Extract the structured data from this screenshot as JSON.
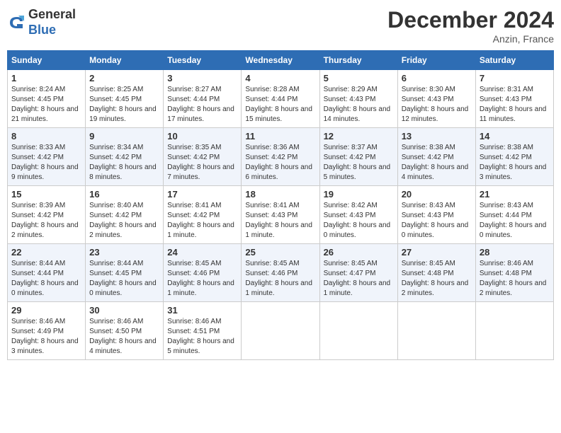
{
  "header": {
    "logo_line1": "General",
    "logo_line2": "Blue",
    "month_title": "December 2024",
    "location": "Anzin, France"
  },
  "weekdays": [
    "Sunday",
    "Monday",
    "Tuesday",
    "Wednesday",
    "Thursday",
    "Friday",
    "Saturday"
  ],
  "weeks": [
    [
      {
        "day": "1",
        "sunrise": "Sunrise: 8:24 AM",
        "sunset": "Sunset: 4:45 PM",
        "daylight": "Daylight: 8 hours and 21 minutes."
      },
      {
        "day": "2",
        "sunrise": "Sunrise: 8:25 AM",
        "sunset": "Sunset: 4:45 PM",
        "daylight": "Daylight: 8 hours and 19 minutes."
      },
      {
        "day": "3",
        "sunrise": "Sunrise: 8:27 AM",
        "sunset": "Sunset: 4:44 PM",
        "daylight": "Daylight: 8 hours and 17 minutes."
      },
      {
        "day": "4",
        "sunrise": "Sunrise: 8:28 AM",
        "sunset": "Sunset: 4:44 PM",
        "daylight": "Daylight: 8 hours and 15 minutes."
      },
      {
        "day": "5",
        "sunrise": "Sunrise: 8:29 AM",
        "sunset": "Sunset: 4:43 PM",
        "daylight": "Daylight: 8 hours and 14 minutes."
      },
      {
        "day": "6",
        "sunrise": "Sunrise: 8:30 AM",
        "sunset": "Sunset: 4:43 PM",
        "daylight": "Daylight: 8 hours and 12 minutes."
      },
      {
        "day": "7",
        "sunrise": "Sunrise: 8:31 AM",
        "sunset": "Sunset: 4:43 PM",
        "daylight": "Daylight: 8 hours and 11 minutes."
      }
    ],
    [
      {
        "day": "8",
        "sunrise": "Sunrise: 8:33 AM",
        "sunset": "Sunset: 4:42 PM",
        "daylight": "Daylight: 8 hours and 9 minutes."
      },
      {
        "day": "9",
        "sunrise": "Sunrise: 8:34 AM",
        "sunset": "Sunset: 4:42 PM",
        "daylight": "Daylight: 8 hours and 8 minutes."
      },
      {
        "day": "10",
        "sunrise": "Sunrise: 8:35 AM",
        "sunset": "Sunset: 4:42 PM",
        "daylight": "Daylight: 8 hours and 7 minutes."
      },
      {
        "day": "11",
        "sunrise": "Sunrise: 8:36 AM",
        "sunset": "Sunset: 4:42 PM",
        "daylight": "Daylight: 8 hours and 6 minutes."
      },
      {
        "day": "12",
        "sunrise": "Sunrise: 8:37 AM",
        "sunset": "Sunset: 4:42 PM",
        "daylight": "Daylight: 8 hours and 5 minutes."
      },
      {
        "day": "13",
        "sunrise": "Sunrise: 8:38 AM",
        "sunset": "Sunset: 4:42 PM",
        "daylight": "Daylight: 8 hours and 4 minutes."
      },
      {
        "day": "14",
        "sunrise": "Sunrise: 8:38 AM",
        "sunset": "Sunset: 4:42 PM",
        "daylight": "Daylight: 8 hours and 3 minutes."
      }
    ],
    [
      {
        "day": "15",
        "sunrise": "Sunrise: 8:39 AM",
        "sunset": "Sunset: 4:42 PM",
        "daylight": "Daylight: 8 hours and 2 minutes."
      },
      {
        "day": "16",
        "sunrise": "Sunrise: 8:40 AM",
        "sunset": "Sunset: 4:42 PM",
        "daylight": "Daylight: 8 hours and 2 minutes."
      },
      {
        "day": "17",
        "sunrise": "Sunrise: 8:41 AM",
        "sunset": "Sunset: 4:42 PM",
        "daylight": "Daylight: 8 hours and 1 minute."
      },
      {
        "day": "18",
        "sunrise": "Sunrise: 8:41 AM",
        "sunset": "Sunset: 4:43 PM",
        "daylight": "Daylight: 8 hours and 1 minute."
      },
      {
        "day": "19",
        "sunrise": "Sunrise: 8:42 AM",
        "sunset": "Sunset: 4:43 PM",
        "daylight": "Daylight: 8 hours and 0 minutes."
      },
      {
        "day": "20",
        "sunrise": "Sunrise: 8:43 AM",
        "sunset": "Sunset: 4:43 PM",
        "daylight": "Daylight: 8 hours and 0 minutes."
      },
      {
        "day": "21",
        "sunrise": "Sunrise: 8:43 AM",
        "sunset": "Sunset: 4:44 PM",
        "daylight": "Daylight: 8 hours and 0 minutes."
      }
    ],
    [
      {
        "day": "22",
        "sunrise": "Sunrise: 8:44 AM",
        "sunset": "Sunset: 4:44 PM",
        "daylight": "Daylight: 8 hours and 0 minutes."
      },
      {
        "day": "23",
        "sunrise": "Sunrise: 8:44 AM",
        "sunset": "Sunset: 4:45 PM",
        "daylight": "Daylight: 8 hours and 0 minutes."
      },
      {
        "day": "24",
        "sunrise": "Sunrise: 8:45 AM",
        "sunset": "Sunset: 4:46 PM",
        "daylight": "Daylight: 8 hours and 1 minute."
      },
      {
        "day": "25",
        "sunrise": "Sunrise: 8:45 AM",
        "sunset": "Sunset: 4:46 PM",
        "daylight": "Daylight: 8 hours and 1 minute."
      },
      {
        "day": "26",
        "sunrise": "Sunrise: 8:45 AM",
        "sunset": "Sunset: 4:47 PM",
        "daylight": "Daylight: 8 hours and 1 minute."
      },
      {
        "day": "27",
        "sunrise": "Sunrise: 8:45 AM",
        "sunset": "Sunset: 4:48 PM",
        "daylight": "Daylight: 8 hours and 2 minutes."
      },
      {
        "day": "28",
        "sunrise": "Sunrise: 8:46 AM",
        "sunset": "Sunset: 4:48 PM",
        "daylight": "Daylight: 8 hours and 2 minutes."
      }
    ],
    [
      {
        "day": "29",
        "sunrise": "Sunrise: 8:46 AM",
        "sunset": "Sunset: 4:49 PM",
        "daylight": "Daylight: 8 hours and 3 minutes."
      },
      {
        "day": "30",
        "sunrise": "Sunrise: 8:46 AM",
        "sunset": "Sunset: 4:50 PM",
        "daylight": "Daylight: 8 hours and 4 minutes."
      },
      {
        "day": "31",
        "sunrise": "Sunrise: 8:46 AM",
        "sunset": "Sunset: 4:51 PM",
        "daylight": "Daylight: 8 hours and 5 minutes."
      },
      null,
      null,
      null,
      null
    ]
  ]
}
